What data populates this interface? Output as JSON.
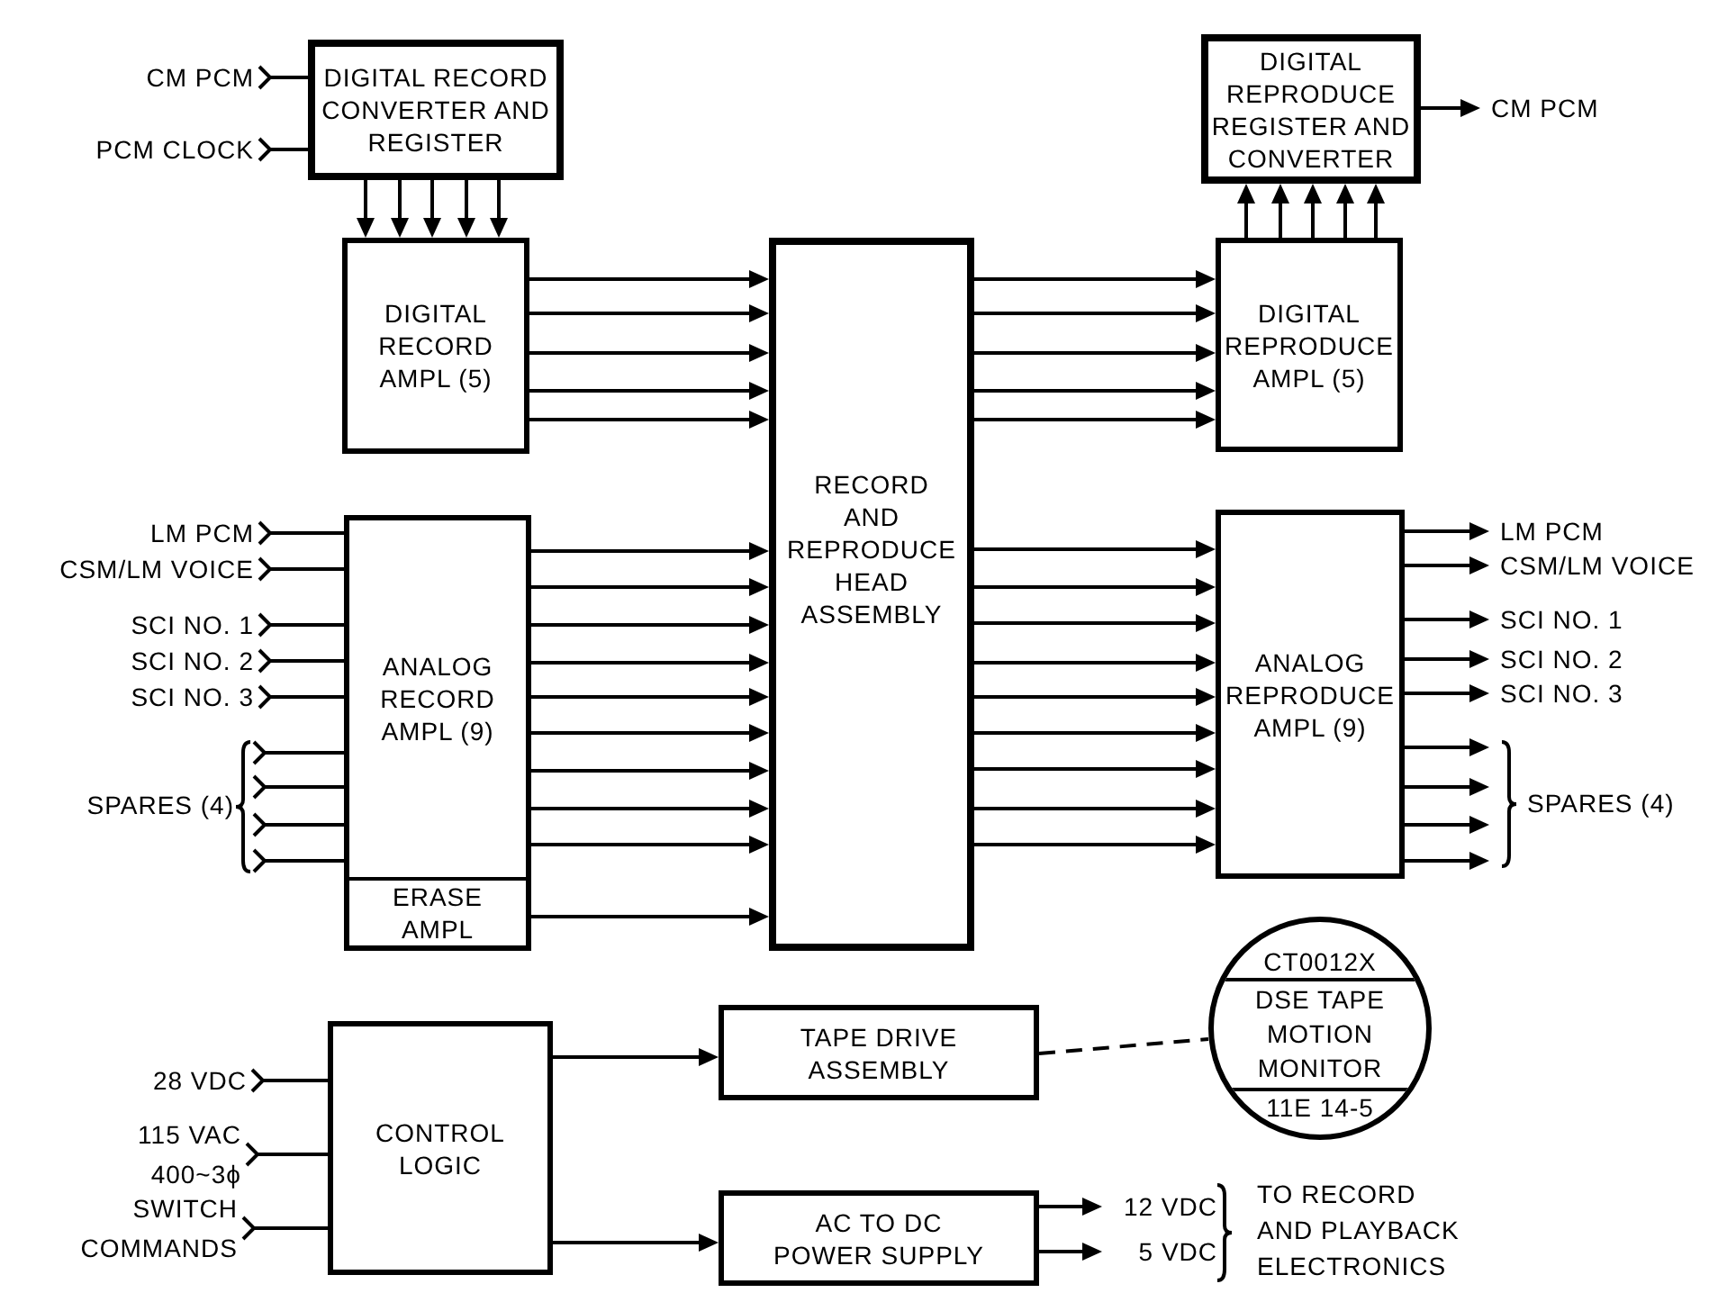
{
  "blocks": [
    {
      "label": "DIGITAL RECORD\nCONVERTER AND\nREGISTER"
    },
    {
      "label": "DIGITAL\nRECORD\nAMPL (5)"
    },
    {
      "label": "RECORD\nAND\nREPRODUCE\nHEAD\nASSEMBLY"
    },
    {
      "label": "DIGITAL\nREPRODUCE\nREGISTER AND\nCONVERTER"
    },
    {
      "label": "DIGITAL\nREPRODUCE\nAMPL (5)"
    },
    {
      "label": "ANALOG\nRECORD\nAMPL (9)",
      "sub_label": "ERASE\nAMPL"
    },
    {
      "label": "ANALOG\nREPRODUCE\nAMPL (9)"
    },
    {
      "label": "CONTROL\nLOGIC"
    },
    {
      "label": "TAPE DRIVE\nASSEMBLY"
    },
    {
      "label": "AC TO DC\nPOWER SUPPLY"
    }
  ],
  "monitor": {
    "header": "CT0012X",
    "label": "DSE TAPE\nMOTION\nMONITOR",
    "footer": "11E 14-5"
  },
  "inputs": [
    {
      "label": "CM PCM"
    },
    {
      "label": "PCM CLOCK"
    },
    {
      "label": "LM PCM"
    },
    {
      "label": "CSM/LM VOICE"
    },
    {
      "label": "SCI NO. 1"
    },
    {
      "label": "SCI NO. 2"
    },
    {
      "label": "SCI NO. 3"
    },
    {
      "label": "SPARES (4)"
    },
    {
      "label": "28 VDC"
    },
    {
      "label": "115 VAC\n400~3ϕ"
    },
    {
      "label": "SWITCH\nCOMMANDS"
    }
  ],
  "outputs": [
    {
      "label": "CM PCM"
    },
    {
      "label": "LM PCM"
    },
    {
      "label": "CSM/LM VOICE"
    },
    {
      "label": "SCI NO. 1"
    },
    {
      "label": "SCI NO. 2"
    },
    {
      "label": "SCI NO. 3"
    },
    {
      "label": "SPARES (4)"
    },
    {
      "label": "12 VDC"
    },
    {
      "label": "5 VDC"
    },
    {
      "label": "TO RECORD\nAND PLAYBACK\nELECTRONICS"
    }
  ]
}
